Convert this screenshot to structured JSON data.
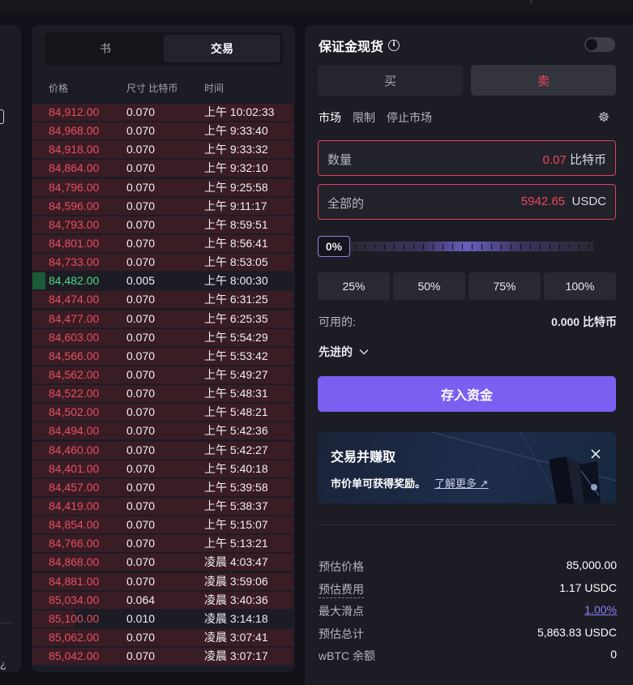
{
  "book_panel": {
    "tabs": [
      "书",
      "交易"
    ],
    "active_tab": 1,
    "columns": {
      "price": "价格",
      "size": "尺寸 比特币",
      "time": "时间"
    },
    "trades": [
      {
        "price": "84,912.00",
        "size": "0.070",
        "time": "上午 10:02:33",
        "side": "sell"
      },
      {
        "price": "84,968.00",
        "size": "0.070",
        "time": "上午 9:33:40",
        "side": "sell"
      },
      {
        "price": "84,918.00",
        "size": "0.070",
        "time": "上午 9:33:32",
        "side": "sell"
      },
      {
        "price": "84,864.00",
        "size": "0.070",
        "time": "上午 9:32:10",
        "side": "sell"
      },
      {
        "price": "84,796.00",
        "size": "0.070",
        "time": "上午 9:25:58",
        "side": "sell"
      },
      {
        "price": "84,596.00",
        "size": "0.070",
        "time": "上午 9:11:17",
        "side": "sell"
      },
      {
        "price": "84,793.00",
        "size": "0.070",
        "time": "上午 8:59:51",
        "side": "sell"
      },
      {
        "price": "84,801.00",
        "size": "0.070",
        "time": "上午 8:56:41",
        "side": "sell"
      },
      {
        "price": "84,733.00",
        "size": "0.070",
        "time": "上午 8:53:05",
        "side": "sell"
      },
      {
        "price": "84,482.00",
        "size": "0.005",
        "time": "上午 8:00:30",
        "side": "buy"
      },
      {
        "price": "84,474.00",
        "size": "0.070",
        "time": "上午 6:31:25",
        "side": "sell"
      },
      {
        "price": "84,477.00",
        "size": "0.070",
        "time": "上午 6:25:35",
        "side": "sell"
      },
      {
        "price": "84,603.00",
        "size": "0.070",
        "time": "上午 5:54:29",
        "side": "sell"
      },
      {
        "price": "84,566.00",
        "size": "0.070",
        "time": "上午 5:53:42",
        "side": "sell"
      },
      {
        "price": "84,562.00",
        "size": "0.070",
        "time": "上午 5:49:27",
        "side": "sell"
      },
      {
        "price": "84,522.00",
        "size": "0.070",
        "time": "上午 5:48:31",
        "side": "sell"
      },
      {
        "price": "84,502.00",
        "size": "0.070",
        "time": "上午 5:48:21",
        "side": "sell"
      },
      {
        "price": "84,494.00",
        "size": "0.070",
        "time": "上午 5:42:36",
        "side": "sell"
      },
      {
        "price": "84,460.00",
        "size": "0.070",
        "time": "上午 5:42:27",
        "side": "sell"
      },
      {
        "price": "84,401.00",
        "size": "0.070",
        "time": "上午 5:40:18",
        "side": "sell"
      },
      {
        "price": "84,457.00",
        "size": "0.070",
        "time": "上午 5:39:58",
        "side": "sell"
      },
      {
        "price": "84,419.00",
        "size": "0.070",
        "time": "上午 5:38:37",
        "side": "sell"
      },
      {
        "price": "84,854.00",
        "size": "0.070",
        "time": "上午 5:15:07",
        "side": "sell"
      },
      {
        "price": "84,766.00",
        "size": "0.070",
        "time": "上午 5:13:21",
        "side": "sell"
      },
      {
        "price": "84,868.00",
        "size": "0.070",
        "time": "凌晨 4:03:47",
        "side": "sell"
      },
      {
        "price": "84,881.00",
        "size": "0.070",
        "time": "凌晨 3:59:06",
        "side": "sell"
      },
      {
        "price": "85,034.00",
        "size": "0.064",
        "time": "凌晨 3:40:36",
        "side": "sell"
      },
      {
        "price": "85,100.00",
        "size": "0.010",
        "time": "凌晨 3:14:18",
        "side": "sell-small"
      },
      {
        "price": "85,062.00",
        "size": "0.070",
        "time": "凌晨 3:07:41",
        "side": "sell"
      },
      {
        "price": "85,042.00",
        "size": "0.070",
        "time": "凌晨 3:07:17",
        "side": "sell"
      }
    ]
  },
  "order_panel": {
    "title": "保证金现货",
    "info_icon": "info-icon",
    "buy_label": "买",
    "sell_label": "卖",
    "order_types": [
      "市场",
      "限制",
      "停止市场"
    ],
    "quantity": {
      "label": "数量",
      "value": "0.07",
      "unit": "比特币"
    },
    "total": {
      "label": "全部的",
      "value": "5942.65",
      "unit": "USDC"
    },
    "slider_value": "0%",
    "slider_fraction": 0,
    "percent_buttons": [
      "25%",
      "50%",
      "75%",
      "100%"
    ],
    "available_label": "可用的:",
    "available_value": "0.000 比特币",
    "advanced_label": "先进的",
    "deposit_label": "存入资金",
    "promo": {
      "title": "交易并赚取",
      "subtitle": "市价单可获得奖励。",
      "link": "了解更多"
    },
    "summary": [
      {
        "label": "预估价格",
        "value": "85,000.00"
      },
      {
        "label": "预估费用",
        "value": "1.17 USDC"
      },
      {
        "label": "最大滑点",
        "value": "1.00%"
      },
      {
        "label": "预估总计",
        "value": "5,863.83 USDC"
      },
      {
        "label": "wBTC 余额",
        "value": "0"
      }
    ]
  },
  "colors": {
    "accent": "#7b5ff0",
    "sell": "#e6505e",
    "buy": "#52d98a",
    "panel": "#1c1c24"
  }
}
